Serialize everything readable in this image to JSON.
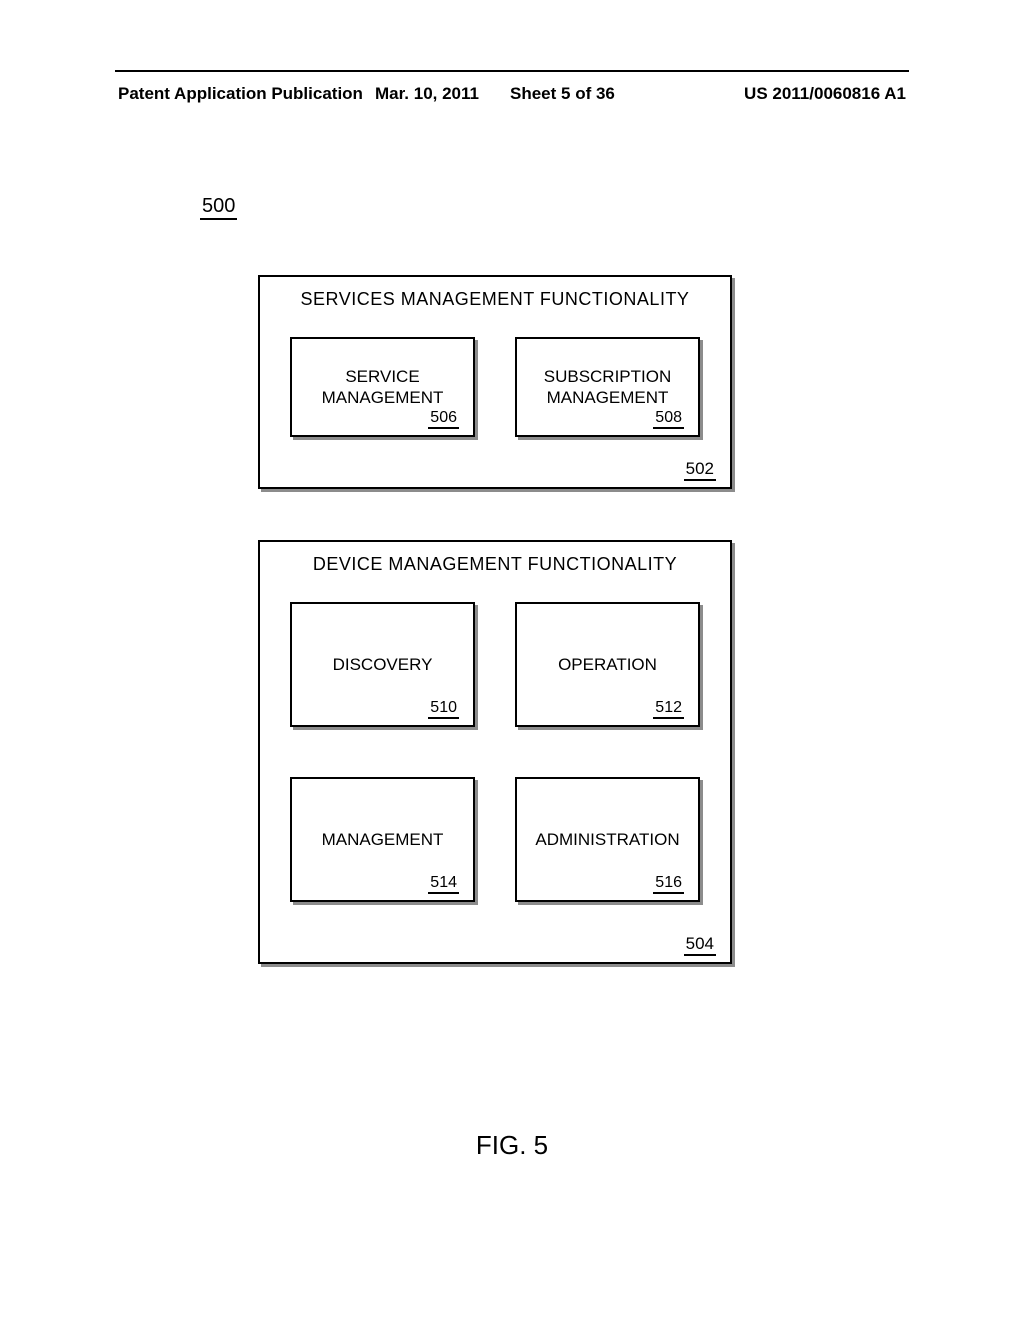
{
  "header": {
    "pub_label": "Patent Application Publication",
    "date": "Mar. 10, 2011",
    "sheet": "Sheet 5 of 36",
    "pub_number": "US 2011/0060816 A1"
  },
  "diagram_ref": "500",
  "blocks": {
    "services": {
      "title": "SERVICES MANAGEMENT FUNCTIONALITY",
      "ref": "502",
      "sub": [
        {
          "label": "SERVICE MANAGEMENT",
          "ref": "506"
        },
        {
          "label": "SUBSCRIPTION MANAGEMENT",
          "ref": "508"
        }
      ]
    },
    "device": {
      "title": "DEVICE MANAGEMENT FUNCTIONALITY",
      "ref": "504",
      "sub": [
        {
          "label": "DISCOVERY",
          "ref": "510"
        },
        {
          "label": "OPERATION",
          "ref": "512"
        },
        {
          "label": "MANAGEMENT",
          "ref": "514"
        },
        {
          "label": "ADMINISTRATION",
          "ref": "516"
        }
      ]
    }
  },
  "figure_label": "FIG. 5"
}
